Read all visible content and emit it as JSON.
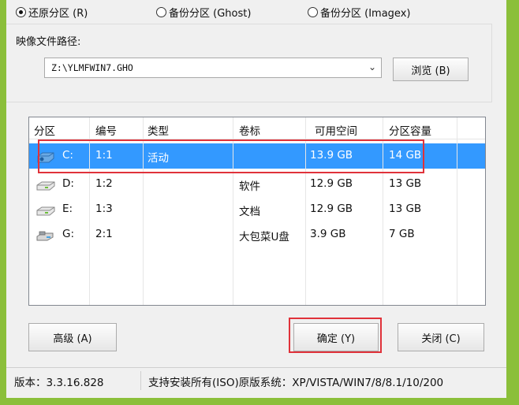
{
  "radios": [
    {
      "label": "还原分区 (R)",
      "checked": true
    },
    {
      "label": "备份分区 (Ghost)",
      "checked": false
    },
    {
      "label": "备份分区 (Imagex)",
      "checked": false
    }
  ],
  "path_label": "映像文件路径:",
  "path_value": "Z:\\YLMFWIN7.GHO",
  "browse_label": "浏览 (B)",
  "columns": [
    "分区",
    "编号",
    "类型",
    "卷标",
    "可用空间",
    "分区容量"
  ],
  "rows": [
    {
      "drive": "C:",
      "id": "1:1",
      "type": "活动",
      "label": "",
      "free": "13.9 GB",
      "size": "14 GB",
      "icon": "system-drive-icon"
    },
    {
      "drive": "D:",
      "id": "1:2",
      "type": "",
      "label": "软件",
      "free": "12.9 GB",
      "size": "13 GB",
      "icon": "hard-drive-icon"
    },
    {
      "drive": "E:",
      "id": "1:3",
      "type": "",
      "label": "文档",
      "free": "12.9 GB",
      "size": "13 GB",
      "icon": "hard-drive-icon"
    },
    {
      "drive": "G:",
      "id": "2:1",
      "type": "",
      "label": "大包菜U盘",
      "free": "3.9 GB",
      "size": "7 GB",
      "icon": "usb-drive-icon"
    }
  ],
  "buttons": {
    "advanced": "高级 (A)",
    "ok": "确定 (Y)",
    "close": "关闭 (C)"
  },
  "status": {
    "version": "版本：3.3.16.828",
    "support": "支持安装所有(ISO)原版系统：XP/VISTA/WIN7/8/8.1/10/200"
  },
  "colors": {
    "selection": "#3399ff",
    "highlight": "#e0323a",
    "background": "#8bbf3a"
  }
}
